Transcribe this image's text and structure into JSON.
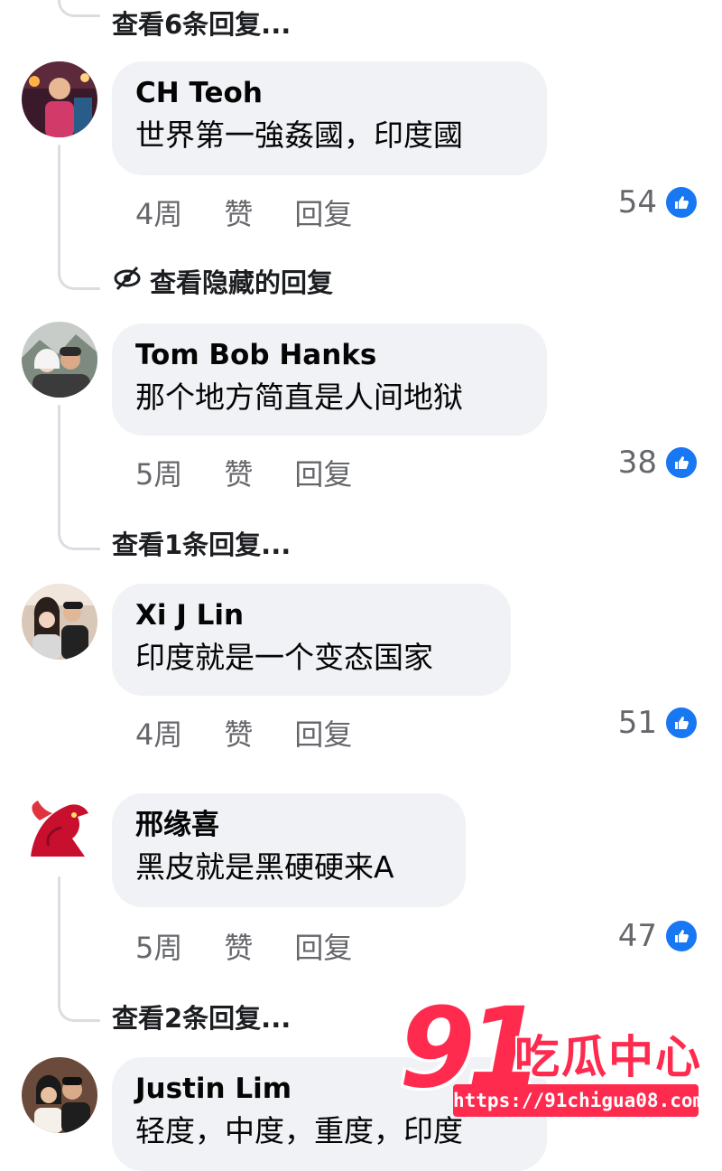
{
  "top_view_replies": "查看6条回复...",
  "comments": [
    {
      "author": "CH Teoh",
      "text": "世界第一強姦國，印度國",
      "time": "4周",
      "like_label": "赞",
      "reply_label": "回复",
      "likes": "54",
      "view_replies": "查看隐藏的回复",
      "view_replies_icon": "eye-slash-icon"
    },
    {
      "author": "Tom Bob Hanks",
      "text": "那个地方简直是人间地狱",
      "time": "5周",
      "like_label": "赞",
      "reply_label": "回复",
      "likes": "38",
      "view_replies": "查看1条回复..."
    },
    {
      "author": "Xi J Lin",
      "text": "印度就是一个变态国家",
      "time": "4周",
      "like_label": "赞",
      "reply_label": "回复",
      "likes": "51"
    },
    {
      "author": "邢缘喜",
      "text": "黑皮就是黑硬硬来A",
      "time": "5周",
      "like_label": "赞",
      "reply_label": "回复",
      "likes": "47",
      "view_replies": "查看2条回复..."
    },
    {
      "author": "Justin Lim",
      "text": "轻度，中度，重度，印度"
    }
  ],
  "watermark": {
    "number": "91",
    "name": "吃瓜中心",
    "url": "https://91chigua08.com"
  },
  "colors": {
    "bubble": "#f0f2f5",
    "like_blue": "#1877f2",
    "muted_text": "#65676b",
    "watermark_red": "#ff2b4f"
  }
}
